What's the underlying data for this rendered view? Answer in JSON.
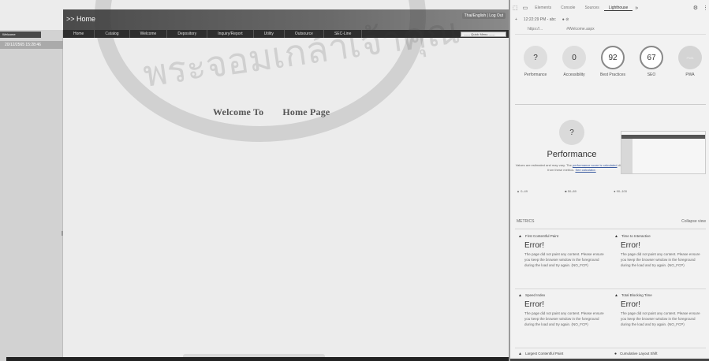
{
  "app": {
    "title": ">> Home",
    "lang_links": "Thai/English | Log Out",
    "nav": [
      "Home",
      "Catalog",
      "Welcome",
      "Depository",
      "Inquiry/Report",
      "Utility",
      "Outsource",
      "SEC-Line"
    ],
    "quick_menu": "------ Quick Menu ------",
    "sidebar_tab": "Welcome",
    "sidebar_date": "20/12/2565 15:28:46",
    "welcome_left": "Welcome To",
    "welcome_right": "Home Page"
  },
  "watermark": {
    "text": "พระจอมเกล้าเจ้าคุณ"
  },
  "devtools": {
    "tabs": [
      "Elements",
      "Console",
      "Sources",
      "Lighthouse"
    ],
    "active_tab": "Lighthouse",
    "toolbar": [
      "+",
      "12:22:29 PM - abc",
      "● ⊘"
    ],
    "url_bar": [
      "https://...",
      "#Welcome.aspx"
    ],
    "scores": [
      {
        "label": "Performance",
        "value": "?",
        "style": "plain"
      },
      {
        "label": "Accessibility",
        "value": "0",
        "style": "plain"
      },
      {
        "label": "Best Practices",
        "value": "92",
        "style": "ring"
      },
      {
        "label": "SEO",
        "value": "67",
        "style": "ring"
      },
      {
        "label": "PWA",
        "value": "PWA",
        "style": "pwa"
      }
    ],
    "perf": {
      "value": "?",
      "title": "Performance",
      "desc_1": "Values are estimated and may vary. The",
      "desc_link": "performance score is calculated",
      "desc_2": "directly from these metrics.",
      "desc_link2": "See calculator."
    },
    "legend": [
      "▲ 0–49",
      "■ 50–89",
      "● 90–100"
    ],
    "metrics_header": "METRICS",
    "collapse_view": "Collapse view",
    "metrics": [
      {
        "name": "First Contentful Paint",
        "value": "Error!",
        "desc": "The page did not paint any content. Please ensure you keep the browser window in the foreground during the load and try again. (NO_FCP)"
      },
      {
        "name": "Time to Interactive",
        "value": "Error!",
        "desc": "The page did not paint any content. Please ensure you keep the browser window in the foreground during the load and try again. (NO_FCP)"
      },
      {
        "name": "Speed Index",
        "value": "Error!",
        "desc": "The page did not paint any content. Please ensure you keep the browser window in the foreground during the load and try again. (NO_FCP)"
      },
      {
        "name": "Total Blocking Time",
        "value": "Error!",
        "desc": "The page did not paint any content. Please ensure you keep the browser window in the foreground during the load and try again. (NO_FCP)"
      },
      {
        "name": "Largest Contentful Paint",
        "value": "",
        "desc": ""
      },
      {
        "name": "Cumulative Layout Shift",
        "value": "",
        "desc": ""
      }
    ]
  }
}
